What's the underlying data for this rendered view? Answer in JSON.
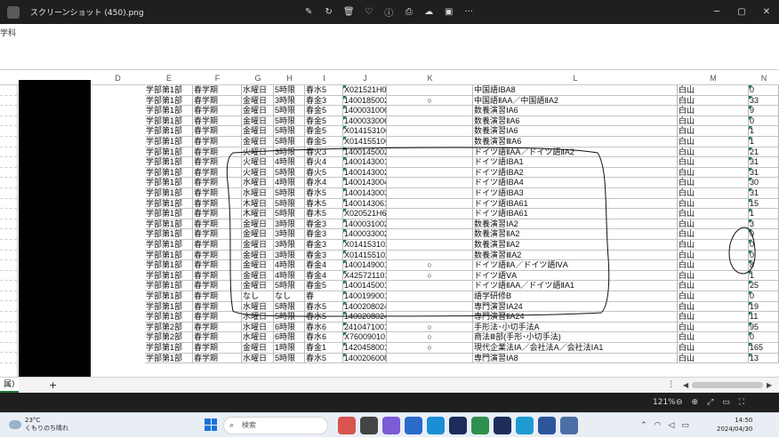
{
  "window": {
    "title": "スクリーンショット (450).png",
    "tool_icons": [
      "edit-icon",
      "rotate-icon",
      "delete-icon",
      "favorite-icon",
      "info-icon",
      "print-icon",
      "cloud-icon",
      "clipchamp-icon",
      "more-icon"
    ],
    "controls": [
      "minimize-icon",
      "maximize-icon",
      "close-icon"
    ]
  },
  "ribbon": {
    "label": "学科"
  },
  "columns": [
    "D",
    "E",
    "F",
    "G",
    "H",
    "I",
    "J",
    "K",
    "L",
    "M",
    "N"
  ],
  "rows": [
    [
      "学部第1部",
      "春学期",
      "水曜日",
      "5時限",
      "春水5",
      "X021521H08",
      "",
      "中国語ⅠBA8",
      "白山",
      "0"
    ],
    [
      "学部第1部",
      "春学期",
      "金曜日",
      "3時限",
      "春金3",
      "1400185002",
      "○",
      "中国語ⅡAA／中国語ⅡA2",
      "白山",
      "33"
    ],
    [
      "学部第1部",
      "春学期",
      "金曜日",
      "5時限",
      "春金5",
      "1400031006",
      "",
      "数養演習ⅠA6",
      "白山",
      "9"
    ],
    [
      "学部第1部",
      "春学期",
      "金曜日",
      "5時限",
      "春金5",
      "1400033006",
      "",
      "数養演習ⅡA6",
      "白山",
      "0"
    ],
    [
      "学部第1部",
      "春学期",
      "金曜日",
      "5時限",
      "春金5",
      "X014153106",
      "",
      "数養演習ⅠA6",
      "白山",
      "1"
    ],
    [
      "学部第1部",
      "春学期",
      "金曜日",
      "5時限",
      "春金5",
      "X014155106",
      "",
      "数養演習ⅢA6",
      "白山",
      "1"
    ],
    [
      "学部第1部",
      "春学期",
      "火曜日",
      "3時限",
      "春火3",
      "1400145002",
      "",
      "ドイツ語ⅡAA／ドイツ語ⅡA2",
      "白山",
      "21"
    ],
    [
      "学部第1部",
      "春学期",
      "火曜日",
      "4時限",
      "春火4",
      "1400143001",
      "",
      "ドイツ語ⅠBA1",
      "白山",
      "31"
    ],
    [
      "学部第1部",
      "春学期",
      "火曜日",
      "5時限",
      "春火5",
      "1400143002",
      "",
      "ドイツ語ⅠBA2",
      "白山",
      "31"
    ],
    [
      "学部第1部",
      "春学期",
      "水曜日",
      "4時限",
      "春水4",
      "1400143004",
      "",
      "ドイツ語ⅠBA4",
      "白山",
      "30"
    ],
    [
      "学部第1部",
      "春学期",
      "水曜日",
      "5時限",
      "春水5",
      "1400143003",
      "",
      "ドイツ語ⅠBA3",
      "白山",
      "31"
    ],
    [
      "学部第1部",
      "春学期",
      "木曜日",
      "5時限",
      "春木5",
      "1400143061",
      "",
      "ドイツ語ⅠBA61",
      "白山",
      "15"
    ],
    [
      "学部第1部",
      "春学期",
      "木曜日",
      "5時限",
      "春木5",
      "X020521H61",
      "",
      "ドイツ語ⅠBA61",
      "白山",
      "1"
    ],
    [
      "学部第1部",
      "春学期",
      "金曜日",
      "3時限",
      "春金3",
      "1400031002",
      "",
      "数養演習ⅠA2",
      "白山",
      "3"
    ],
    [
      "学部第1部",
      "春学期",
      "金曜日",
      "3時限",
      "春金3",
      "1400033002",
      "",
      "数養演習ⅡA2",
      "白山",
      "0"
    ],
    [
      "学部第1部",
      "春学期",
      "金曜日",
      "3時限",
      "春金3",
      "X014153102",
      "",
      "数養演習ⅡA2",
      "白山",
      "0"
    ],
    [
      "学部第1部",
      "春学期",
      "金曜日",
      "3時限",
      "春金3",
      "X014155102",
      "",
      "数養演習ⅢA2",
      "白山",
      "0"
    ],
    [
      "学部第1部",
      "春学期",
      "金曜日",
      "4時限",
      "春金4",
      "1400149001",
      "○",
      "ドイツ語ⅡA／ドイツ語ⅣA",
      "白山",
      "8"
    ],
    [
      "学部第1部",
      "春学期",
      "金曜日",
      "4時限",
      "春金4",
      "X425721101",
      "○",
      "ドイツ語ⅤA",
      "白山",
      "1"
    ],
    [
      "学部第1部",
      "春学期",
      "金曜日",
      "5時限",
      "春金5",
      "1400145001",
      "",
      "ドイツ語ⅡAA／ドイツ語ⅡA1",
      "白山",
      "25"
    ],
    [
      "学部第1部",
      "春学期",
      "なし",
      "なし",
      "春",
      "1400199001",
      "",
      "語学研修B",
      "白山",
      "0"
    ],
    [
      "学部第1部",
      "春学期",
      "水曜日",
      "5時限",
      "春水5",
      "1400208024",
      "",
      "専門演習ⅠA24",
      "白山",
      "19"
    ],
    [
      "学部第1部",
      "春学期",
      "水曜日",
      "5時限",
      "春水5",
      "1400208024",
      "",
      "専門演習ⅡA24",
      "白山",
      "11"
    ],
    [
      "学部第2部",
      "春学期",
      "水曜日",
      "6時限",
      "春水6",
      "2410471001",
      "○",
      "手形法･小切手法A",
      "白山",
      "95"
    ],
    [
      "学部第2部",
      "春学期",
      "水曜日",
      "6時限",
      "春水6",
      "X760090101",
      "○",
      "商法Ⅲ部(手形･小切手法)",
      "白山",
      "0"
    ],
    [
      "学部第1部",
      "春学期",
      "金曜日",
      "1時限",
      "春金1",
      "1420458001",
      "○",
      "現代企業法ⅠA／会社法A／会社法ⅠA1",
      "白山",
      "165"
    ],
    [
      "学部第1部",
      "春学期",
      "水曜日",
      "5時限",
      "春水5",
      "1400206008",
      "",
      "専門演習ⅠA8",
      "白山",
      "13"
    ]
  ],
  "sheet_tab": "属)",
  "add_sheet": "+",
  "tab_menu": "⋮",
  "status": {
    "zoom": "121%"
  },
  "taskbar": {
    "temp": "23°C",
    "weather": "くもりのち晴れ",
    "search_placeholder": "検索",
    "time": "14:50",
    "date": "2024/04/30"
  }
}
